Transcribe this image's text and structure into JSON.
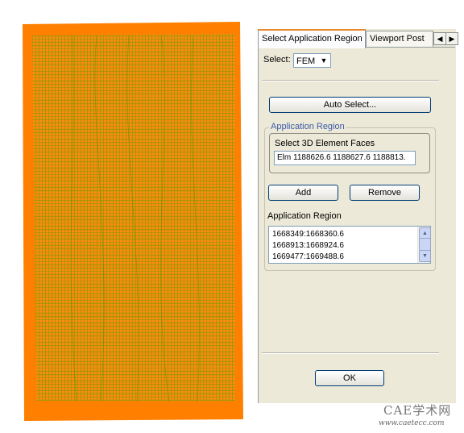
{
  "tabs": [
    {
      "label": "Select Application Region",
      "active": true
    },
    {
      "label": "Viewport Post",
      "active": false
    }
  ],
  "tab_nav": {
    "prev_icon": "arrow-left-icon",
    "next_icon": "arrow-right-icon"
  },
  "select": {
    "label": "Select:",
    "value": "FEM"
  },
  "auto_select_label": "Auto Select...",
  "app_region_group": {
    "title": "Application Region",
    "subtitle": "Select 3D Element Faces",
    "entry_value": "Elm 1188626.6 1188627.6 1188813."
  },
  "add_label": "Add",
  "remove_label": "Remove",
  "list": {
    "label": "Application Region",
    "items": [
      "1668349:1668360.6",
      "1668913:1668924.6",
      "1669477:1669488.6"
    ]
  },
  "ok_label": "OK",
  "watermark": {
    "title": "CAE学术网",
    "url": "www.caetecc.com"
  },
  "colors": {
    "mesh_border": "#ff7f00",
    "mesh_lines": "#6e9a00",
    "tab_accent": "#e68b2c"
  }
}
